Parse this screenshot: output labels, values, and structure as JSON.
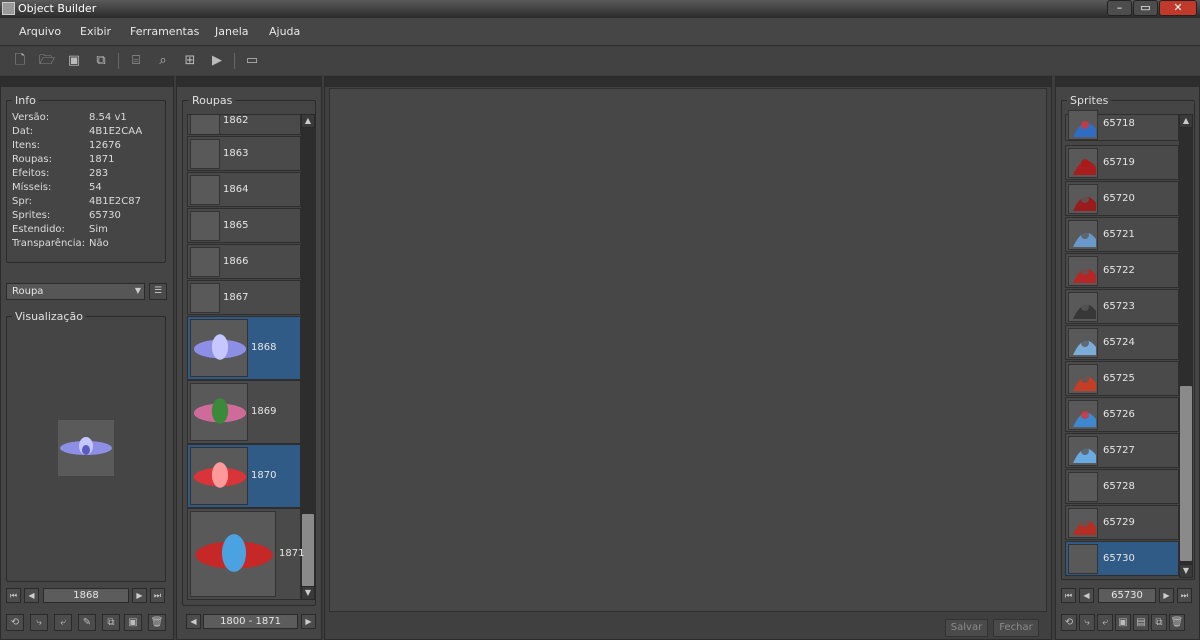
{
  "window": {
    "title": "Object Builder",
    "min": "–",
    "max": "▭",
    "close": "✕"
  },
  "menu": [
    "Arquivo",
    "Exibir",
    "Ferramentas",
    "Janela",
    "Ajuda"
  ],
  "info": {
    "title": "Info",
    "rows": [
      {
        "k": "Versão:",
        "v": "8.54 v1"
      },
      {
        "k": "Dat:",
        "v": "4B1E2CAA"
      },
      {
        "k": "Itens:",
        "v": "12676"
      },
      {
        "k": "Roupas:",
        "v": "1871"
      },
      {
        "k": "Efeitos:",
        "v": "283"
      },
      {
        "k": "Mísseis:",
        "v": "54"
      },
      {
        "k": "Spr:",
        "v": "4B1E2C87"
      },
      {
        "k": "Sprites:",
        "v": "65730"
      },
      {
        "k": "Estendido:",
        "v": "Sim"
      },
      {
        "k": "Transparência:",
        "v": "Não"
      }
    ]
  },
  "category": {
    "value": "Roupa"
  },
  "preview": {
    "title": "Visualização"
  },
  "left_nav": {
    "value": "1868"
  },
  "roupas": {
    "title": "Roupas",
    "items": [
      "1862",
      "1863",
      "1864",
      "1865",
      "1866",
      "1867",
      "1868",
      "1869",
      "1870",
      "1871"
    ],
    "range": "1800 - 1871"
  },
  "sprites": {
    "title": "Sprites",
    "items": [
      "65718",
      "65719",
      "65720",
      "65721",
      "65722",
      "65723",
      "65724",
      "65725",
      "65726",
      "65727",
      "65728",
      "65729",
      "65730"
    ],
    "nav_value": "65730"
  },
  "footer": {
    "save": "Salvar",
    "close": "Fechar"
  },
  "colors": {
    "accent": "#2f5b86",
    "bg": "#3d3d3d"
  }
}
